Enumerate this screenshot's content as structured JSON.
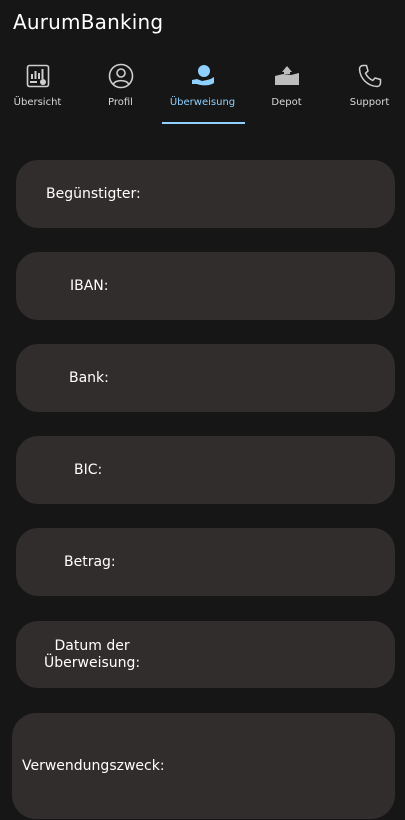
{
  "app": {
    "title": "AurumBanking"
  },
  "tabs": [
    {
      "label": "Übersicht",
      "icon": "dashboard-icon"
    },
    {
      "label": "Profil",
      "icon": "profile-icon"
    },
    {
      "label": "Überweisung",
      "icon": "transfer-icon",
      "active": true
    },
    {
      "label": "Depot",
      "icon": "depot-icon"
    },
    {
      "label": "Support",
      "icon": "phone-icon"
    }
  ],
  "form": {
    "beneficiary_label": "Begünstigter:",
    "iban_label": "IBAN:",
    "bank_label": "Bank:",
    "bic_label": "BIC:",
    "amount_label": "Betrag:",
    "date_label_line1": "Datum der",
    "date_label_line2": "Überweisung:",
    "purpose_label": "Verwendungszweck:"
  },
  "colors": {
    "background": "#161616",
    "field": "#312d2c",
    "accent": "#8fd0ff"
  }
}
